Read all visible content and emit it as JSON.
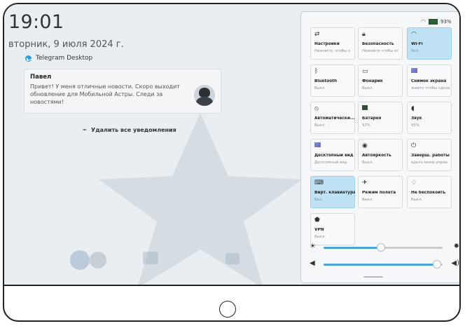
{
  "lock": {
    "time": "19:01",
    "date": "вторник, 9 июля 2024 г."
  },
  "status": {
    "battery": "93%"
  },
  "notification": {
    "app": "Telegram Desktop",
    "title": "Павел",
    "body": "Привет! У меня отличные новости. Скоро выходит обновление для Мобильной Астры. Следи за новостями!",
    "clear_all": "Удалить все уведомления"
  },
  "tiles": [
    {
      "title": "Настройки",
      "status": "Нажмите, чтобы о",
      "icon": "settings-sliders-icon",
      "active": false
    },
    {
      "title": "Безопасность",
      "status": "Нажмите чтобы от",
      "icon": "lock-icon",
      "active": false
    },
    {
      "title": "Wi-Fi",
      "status": "Вкл.",
      "icon": "wifi-icon",
      "active": true
    },
    {
      "title": "Bluetooth",
      "status": "Выкл.",
      "icon": "bluetooth-icon",
      "active": false
    },
    {
      "title": "Фонарик",
      "status": "Выкл.",
      "icon": "flashlight-icon",
      "active": false
    },
    {
      "title": "Снимок экрана",
      "status": "жмите чтобы сдела",
      "icon": "screenshot-icon",
      "active": false
    },
    {
      "title": "Автоматически...",
      "status": "Выкл.",
      "icon": "auto-rotate-icon",
      "active": false
    },
    {
      "title": "Батарея",
      "status": "93%",
      "icon": "battery-icon",
      "active": false
    },
    {
      "title": "Звук",
      "status": "95%",
      "icon": "volume-icon",
      "active": false
    },
    {
      "title": "Десктопный вид",
      "status": "Десктопный вид",
      "icon": "desktop-view-icon",
      "active": false
    },
    {
      "title": "Автояркость",
      "status": "Выкл.",
      "icon": "auto-brightness-icon",
      "active": false
    },
    {
      "title": "Заверш. работы",
      "status": "крыть меню управ",
      "icon": "power-icon",
      "active": false
    },
    {
      "title": "Вирт. клавиатура",
      "status": "Вкл.",
      "icon": "keyboard-icon",
      "active": true
    },
    {
      "title": "Режим полёта",
      "status": "Выкл.",
      "icon": "airplane-icon",
      "active": false
    },
    {
      "title": "Не беспокоить",
      "status": "Выкл.",
      "icon": "bell-icon",
      "active": false
    },
    {
      "title": "VPN",
      "status": "Выкл.",
      "icon": "vpn-shield-icon",
      "active": false
    }
  ],
  "sliders": {
    "brightness": 0.48,
    "volume": 0.95
  },
  "colors": {
    "accent": "#4aa6dd",
    "active_tile": "#bfe3f4"
  }
}
